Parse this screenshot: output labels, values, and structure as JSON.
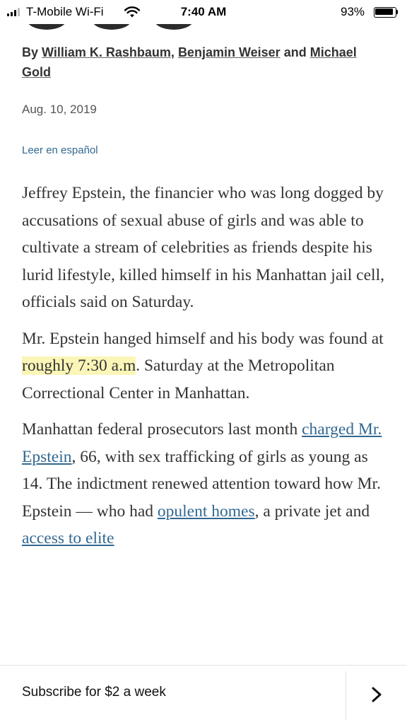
{
  "status_bar": {
    "carrier": "T-Mobile Wi-Fi",
    "time": "7:40 AM",
    "battery": "93%",
    "battery_level": 0.93
  },
  "article": {
    "byline_prefix": "By",
    "authors": [
      "William K. Rashbaum",
      "Benjamin Weiser",
      "Michael Gold"
    ],
    "byline_sep": ",",
    "byline_and": "and",
    "date": "Aug. 10, 2019",
    "translation_link": "Leer en español",
    "paragraphs": [
      {
        "text": "Jeffrey Epstein, the financier who was long dogged by accusations of sexual abuse of girls and was able to cultivate a stream of celebrities as friends despite his lurid lifestyle, killed himself in his Manhattan jail cell, officials said on Saturday."
      },
      {
        "before": "Mr. Epstein hanged himself and his body was found at ",
        "highlight": "roughly 7:30 a.m",
        "after": ". Saturday at the Metropolitan Correctional Center in Manhattan."
      },
      {
        "t1": "Manhattan federal prosecutors last month ",
        "link1": "charged Mr. Epstein",
        "t2": ", 66, with sex trafficking of girls as young as 14. The indictment renewed attention toward how Mr. Epstein — who had ",
        "link2": "opulent homes",
        "t3": ", a private jet and ",
        "link3": "access to elite",
        "t4": ""
      }
    ]
  },
  "paywall": {
    "subscribe_label": "Subscribe for $2 a week",
    "chevron_icon": "chevron-right-icon"
  },
  "colors": {
    "link": "#326891",
    "highlight": "#fbf6b7",
    "text": "#333333"
  }
}
